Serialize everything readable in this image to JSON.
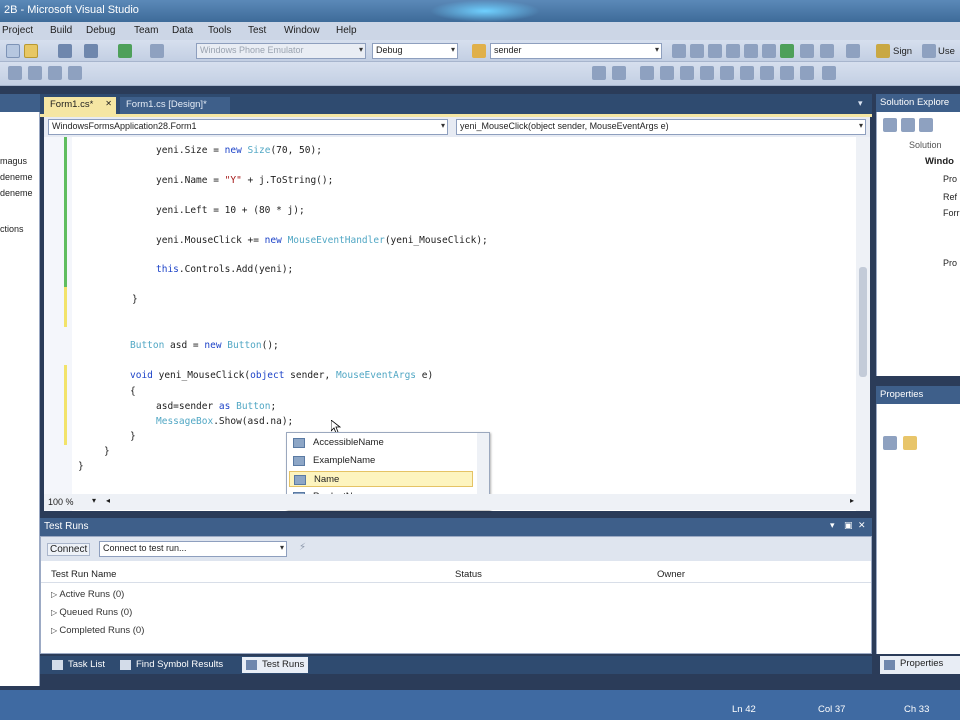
{
  "window": {
    "title_text": "2B - Microsoft Visual Studio"
  },
  "menu": [
    "Project",
    "Build",
    "Debug",
    "Team",
    "Data",
    "Tools",
    "Test",
    "Window",
    "Help"
  ],
  "toolbar": {
    "platform_combo": "Windows Phone Emulator",
    "config_combo": "Debug",
    "find_combo": "sender",
    "signin_label": "Sign",
    "user_label": "Use"
  },
  "left_panel": {
    "items": [
      "magus",
      "deneme",
      "deneme",
      "ctions"
    ]
  },
  "tabs": [
    {
      "label": "Form1.cs*",
      "active": true
    },
    {
      "label": "Form1.cs [Design]*",
      "active": false
    }
  ],
  "navbar": {
    "class_combo": "WindowsFormsApplication28.Form1",
    "member_combo": "yeni_MouseClick(object sender, MouseEventArgs e)"
  },
  "code": {
    "line1": "yeni.Size = new Size(70, 50);",
    "line2": "yeni.Name = \"Y\" + j.ToString();",
    "line3": "yeni.Left = 10 + (80 * j);",
    "line4": "yeni.MouseClick += new MouseEventHandler(yeni_MouseClick);",
    "line5": "this.Controls.Add(yeni);",
    "line6": "}",
    "line7": "Button asd = new Button();",
    "line8": "void yeni_MouseClick(object sender, MouseEventArgs e)",
    "line9": "{",
    "line10": "asd=sender as Button;",
    "line11": "MessageBox.Show(asd.na);",
    "line12": "}",
    "line13": "}",
    "line14": "}"
  },
  "intellisense": {
    "items": [
      "AccessibleName",
      "ExampleName",
      "Name",
      "ProductName"
    ],
    "selected_index": 2
  },
  "editor_footer": {
    "zoom": "100 %"
  },
  "test_runs": {
    "title": "Test Runs",
    "connect_label": "Connect",
    "connect_combo": "Connect to test run...",
    "columns": [
      "Test Run Name",
      "Status",
      "Owner"
    ],
    "groups": [
      "Active Runs (0)",
      "Queued Runs (0)",
      "Completed Runs (0)"
    ]
  },
  "bottom_tabs": [
    "Task List",
    "Find Symbol Results",
    "Test Runs"
  ],
  "solution_explorer": {
    "title": "Solution Explore",
    "search": "Solution",
    "items": [
      "Windo",
      "Pro",
      "Ref",
      "Forr",
      "Pro"
    ]
  },
  "properties": {
    "title": "Properties",
    "tab_label": "Properties"
  },
  "status": {
    "ln": "Ln 42",
    "col": "Col 37",
    "ch": "Ch 33"
  },
  "colors": {
    "keyword": "#1d43c8",
    "type": "#51a7c4",
    "string": "#a31515",
    "chrome": "#2f4b70"
  }
}
